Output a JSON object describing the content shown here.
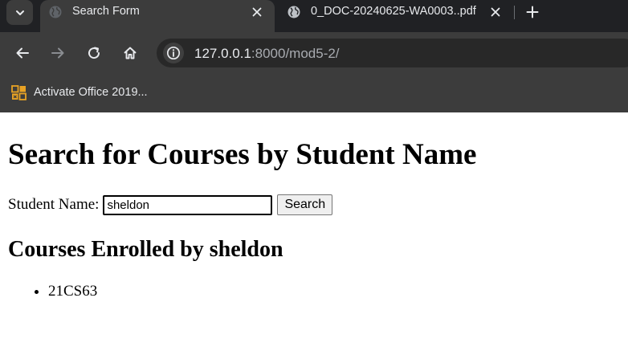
{
  "colors": {
    "tabstrip_bg": "#202124",
    "toolbar_bg": "#3c3c3c",
    "omnibox_bg": "#282828",
    "text_light": "#e8eaed",
    "bookmark_icon": "#e8a224"
  },
  "tabs": [
    {
      "title": "Search Form",
      "favicon": "globe-icon",
      "active": true
    },
    {
      "title": "0_DOC-20240625-WA0003..pdf",
      "favicon": "globe-icon",
      "active": false
    }
  ],
  "address_bar": {
    "host": "127.0.0.1",
    "rest": ":8000/mod5-2/"
  },
  "bookmarks": [
    {
      "label": "Activate Office 2019...",
      "icon": "office-icon"
    }
  ],
  "page": {
    "heading": "Search for Courses by Student Name",
    "form": {
      "label": "Student Name:",
      "input_value": "sheldon",
      "button_label": "Search"
    },
    "results_heading": "Courses Enrolled by sheldon",
    "courses": [
      "21CS63"
    ]
  }
}
